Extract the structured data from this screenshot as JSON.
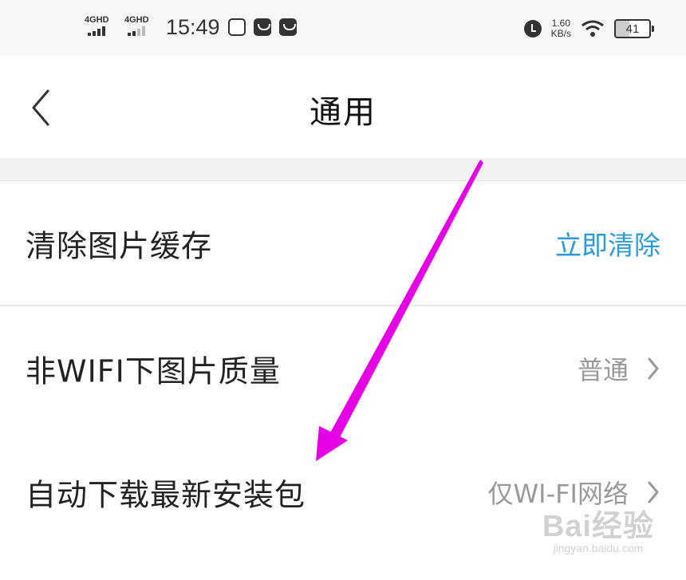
{
  "status_bar": {
    "network1": "4GHD",
    "network2": "4GHD",
    "time": "15:49",
    "speed_value": "1.60",
    "speed_unit": "KB/s",
    "battery": "41"
  },
  "navbar": {
    "title": "通用"
  },
  "settings": {
    "rows": [
      {
        "label": "清除图片缓存",
        "value": "立即清除"
      },
      {
        "label": "非WIFI下图片质量",
        "value": "普通"
      },
      {
        "label": "自动下载最新安装包",
        "value": "仅WI-FI网络"
      }
    ]
  },
  "watermark": {
    "main": "Bai经验",
    "sub": "jingyan.baidu.com"
  },
  "colors": {
    "accent": "#2b9ad8",
    "annotation_arrow": "#e600e6"
  }
}
